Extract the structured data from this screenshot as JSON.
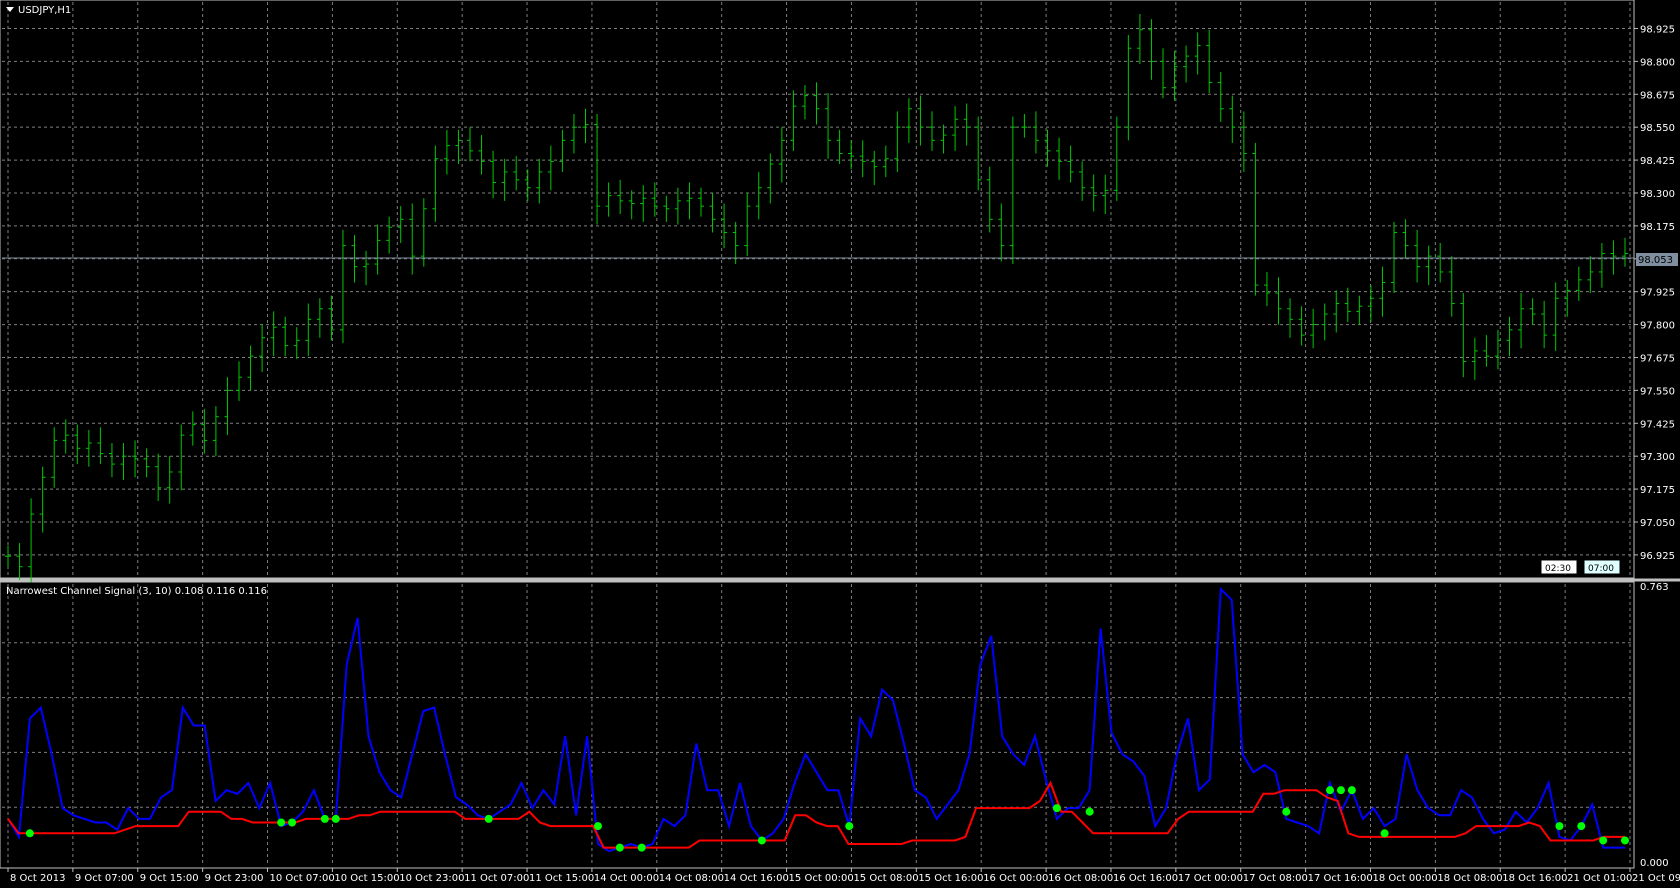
{
  "window": {
    "title": "USDJPY,H1",
    "collapse_icon": "triangle-down-icon"
  },
  "price_panel": {
    "y_ticks": [
      "98.925",
      "98.800",
      "98.675",
      "98.550",
      "98.425",
      "98.300",
      "98.175",
      "98.050",
      "97.925",
      "97.800",
      "97.675",
      "97.550",
      "97.425",
      "97.300",
      "97.175",
      "97.050",
      "96.925"
    ],
    "current_price": "98.053",
    "time_markers": [
      "02:30",
      "07:00"
    ],
    "bar_color": "#00c800",
    "grid_color": "#7f7f7f",
    "price_line_color": "#7f8fa0"
  },
  "indicator_panel": {
    "label": "Narrowest Channel Signal (3, 10) 0.108 0.116 0.116",
    "y_top": "0.763",
    "y_bottom": "0.000",
    "line_colors": {
      "channel": "#0000ff",
      "signal": "#ff0000",
      "dot": "#00ff00"
    }
  },
  "x_axis": {
    "labels": [
      "8 Oct 2013",
      "9 Oct 07:00",
      "9 Oct 15:00",
      "9 Oct 23:00",
      "10 Oct 07:00",
      "10 Oct 15:00",
      "10 Oct 23:00",
      "11 Oct 07:00",
      "11 Oct 15:00",
      "14 Oct 00:00",
      "14 Oct 08:00",
      "14 Oct 16:00",
      "15 Oct 00:00",
      "15 Oct 08:00",
      "15 Oct 16:00",
      "16 Oct 00:00",
      "16 Oct 08:00",
      "16 Oct 16:00",
      "17 Oct 00:00",
      "17 Oct 08:00",
      "17 Oct 16:00",
      "18 Oct 00:00",
      "18 Oct 08:00",
      "18 Oct 16:00",
      "21 Oct 01:00",
      "21 Oct 09:00"
    ]
  },
  "chart_data": [
    {
      "type": "line",
      "title": "USDJPY,H1",
      "series": [
        {
          "name": "USDJPY",
          "values": [
            96.92,
            96.88,
            97.08,
            97.22,
            97.36,
            97.38,
            97.33,
            97.35,
            97.31,
            97.27,
            97.3,
            97.29,
            97.26,
            97.18,
            97.24,
            97.38,
            97.42,
            97.36,
            97.45,
            97.55,
            97.6,
            97.68,
            97.75,
            97.79,
            97.72,
            97.74,
            97.82,
            97.86,
            97.78,
            98.1,
            98.02,
            98.03,
            98.12,
            98.17,
            98.2,
            98.06,
            98.24,
            98.43,
            98.48,
            98.5,
            98.46,
            98.42,
            98.34,
            98.38,
            98.35,
            98.32,
            98.38,
            98.42,
            98.5,
            98.55,
            98.56,
            98.25,
            98.29,
            98.27,
            98.26,
            98.28,
            98.25,
            98.24,
            98.27,
            98.28,
            98.25,
            98.2,
            98.15,
            98.1,
            98.25,
            98.32,
            98.41,
            98.5,
            98.63,
            98.67,
            98.62,
            98.5,
            98.45,
            98.44,
            98.42,
            98.4,
            98.43,
            98.55,
            98.62,
            98.55,
            98.5,
            98.52,
            98.58,
            98.55,
            98.35,
            98.2,
            98.1,
            98.55,
            98.55,
            98.5,
            98.46,
            98.42,
            98.38,
            98.32,
            98.29,
            98.31,
            98.55,
            98.85,
            98.92,
            98.8,
            98.7,
            98.78,
            98.82,
            98.86,
            98.72,
            98.62,
            98.55,
            98.45,
            97.95,
            97.92,
            97.86,
            97.82,
            97.76,
            97.8,
            97.84,
            97.88,
            97.85,
            97.87,
            97.9,
            97.96,
            98.15,
            98.1,
            98.02,
            98.06,
            98.0,
            97.88,
            97.66,
            97.7,
            97.68,
            97.74,
            97.78,
            97.86,
            97.84,
            97.76,
            97.9,
            97.93,
            97.97,
            98.0,
            98.07,
            98.06,
            98.07
          ]
        }
      ],
      "ylim": [
        96.86,
        98.98
      ]
    },
    {
      "type": "line",
      "title": "Narrowest Channel Signal (3, 10) 0.108 0.116 0.116",
      "ylim": [
        0.0,
        0.763
      ],
      "series": [
        {
          "name": "",
          "values": [
            0.12,
            0.07,
            0.4,
            0.43,
            0.3,
            0.15,
            0.13,
            0.12,
            0.11,
            0.11,
            0.09,
            0.15,
            0.12,
            0.12,
            0.18,
            0.2,
            0.43,
            0.38,
            0.38,
            0.17,
            0.2,
            0.19,
            0.22,
            0.15,
            0.22,
            0.1,
            0.11,
            0.14,
            0.2,
            0.12,
            0.12,
            0.55,
            0.68,
            0.35,
            0.25,
            0.2,
            0.18,
            0.3,
            0.42,
            0.43,
            0.3,
            0.18,
            0.16,
            0.13,
            0.12,
            0.14,
            0.16,
            0.22,
            0.15,
            0.2,
            0.16,
            0.35,
            0.13,
            0.35,
            0.05,
            0.03,
            0.04,
            0.05,
            0.04,
            0.05,
            0.12,
            0.1,
            0.13,
            0.33,
            0.2,
            0.2,
            0.1,
            0.22,
            0.1,
            0.06,
            0.08,
            0.12,
            0.22,
            0.3,
            0.25,
            0.2,
            0.2,
            0.1,
            0.4,
            0.35,
            0.48,
            0.45,
            0.33,
            0.2,
            0.18,
            0.12,
            0.16,
            0.2,
            0.3,
            0.55,
            0.63,
            0.35,
            0.3,
            0.27,
            0.35,
            0.23,
            0.12,
            0.15,
            0.15,
            0.2,
            0.65,
            0.36,
            0.3,
            0.28,
            0.24,
            0.1,
            0.15,
            0.3,
            0.4,
            0.2,
            0.23,
            0.76,
            0.73,
            0.3,
            0.25,
            0.27,
            0.25,
            0.12,
            0.11,
            0.1,
            0.08,
            0.22,
            0.14,
            0.2,
            0.12,
            0.15,
            0.1,
            0.12,
            0.3,
            0.2,
            0.15,
            0.13,
            0.13,
            0.2,
            0.18,
            0.12,
            0.08,
            0.09,
            0.14,
            0.11,
            0.15,
            0.22,
            0.07,
            0.06,
            0.1,
            0.16,
            0.04,
            0.04,
            0.04
          ]
        },
        {
          "name": "",
          "values": [
            0.12,
            0.08,
            0.08,
            0.08,
            0.08,
            0.08,
            0.08,
            0.08,
            0.08,
            0.08,
            0.08,
            0.09,
            0.1,
            0.1,
            0.1,
            0.1,
            0.1,
            0.14,
            0.14,
            0.14,
            0.14,
            0.12,
            0.12,
            0.11,
            0.11,
            0.11,
            0.11,
            0.11,
            0.12,
            0.12,
            0.12,
            0.12,
            0.12,
            0.13,
            0.13,
            0.14,
            0.14,
            0.14,
            0.14,
            0.14,
            0.14,
            0.14,
            0.14,
            0.12,
            0.12,
            0.12,
            0.12,
            0.12,
            0.12,
            0.14,
            0.11,
            0.1,
            0.1,
            0.1,
            0.1,
            0.1,
            0.04,
            0.04,
            0.04,
            0.04,
            0.04,
            0.04,
            0.04,
            0.04,
            0.04,
            0.06,
            0.06,
            0.06,
            0.06,
            0.06,
            0.06,
            0.06,
            0.06,
            0.06,
            0.13,
            0.13,
            0.11,
            0.1,
            0.1,
            0.05,
            0.05,
            0.05,
            0.05,
            0.05,
            0.05,
            0.06,
            0.06,
            0.06,
            0.06,
            0.06,
            0.07,
            0.15,
            0.15,
            0.15,
            0.15,
            0.15,
            0.15,
            0.17,
            0.22,
            0.14,
            0.14,
            0.11,
            0.08,
            0.08,
            0.08,
            0.08,
            0.08,
            0.08,
            0.08,
            0.08,
            0.12,
            0.14,
            0.14,
            0.14,
            0.14,
            0.14,
            0.14,
            0.14,
            0.19,
            0.19,
            0.2,
            0.2,
            0.2,
            0.2,
            0.18,
            0.17,
            0.08,
            0.07,
            0.07,
            0.07,
            0.07,
            0.07,
            0.07,
            0.07,
            0.07,
            0.07,
            0.07,
            0.08,
            0.1,
            0.1,
            0.1,
            0.1,
            0.1,
            0.11,
            0.1,
            0.06,
            0.06,
            0.06,
            0.06,
            0.06,
            0.07,
            0.07,
            0.07
          ]
        }
      ]
    }
  ]
}
